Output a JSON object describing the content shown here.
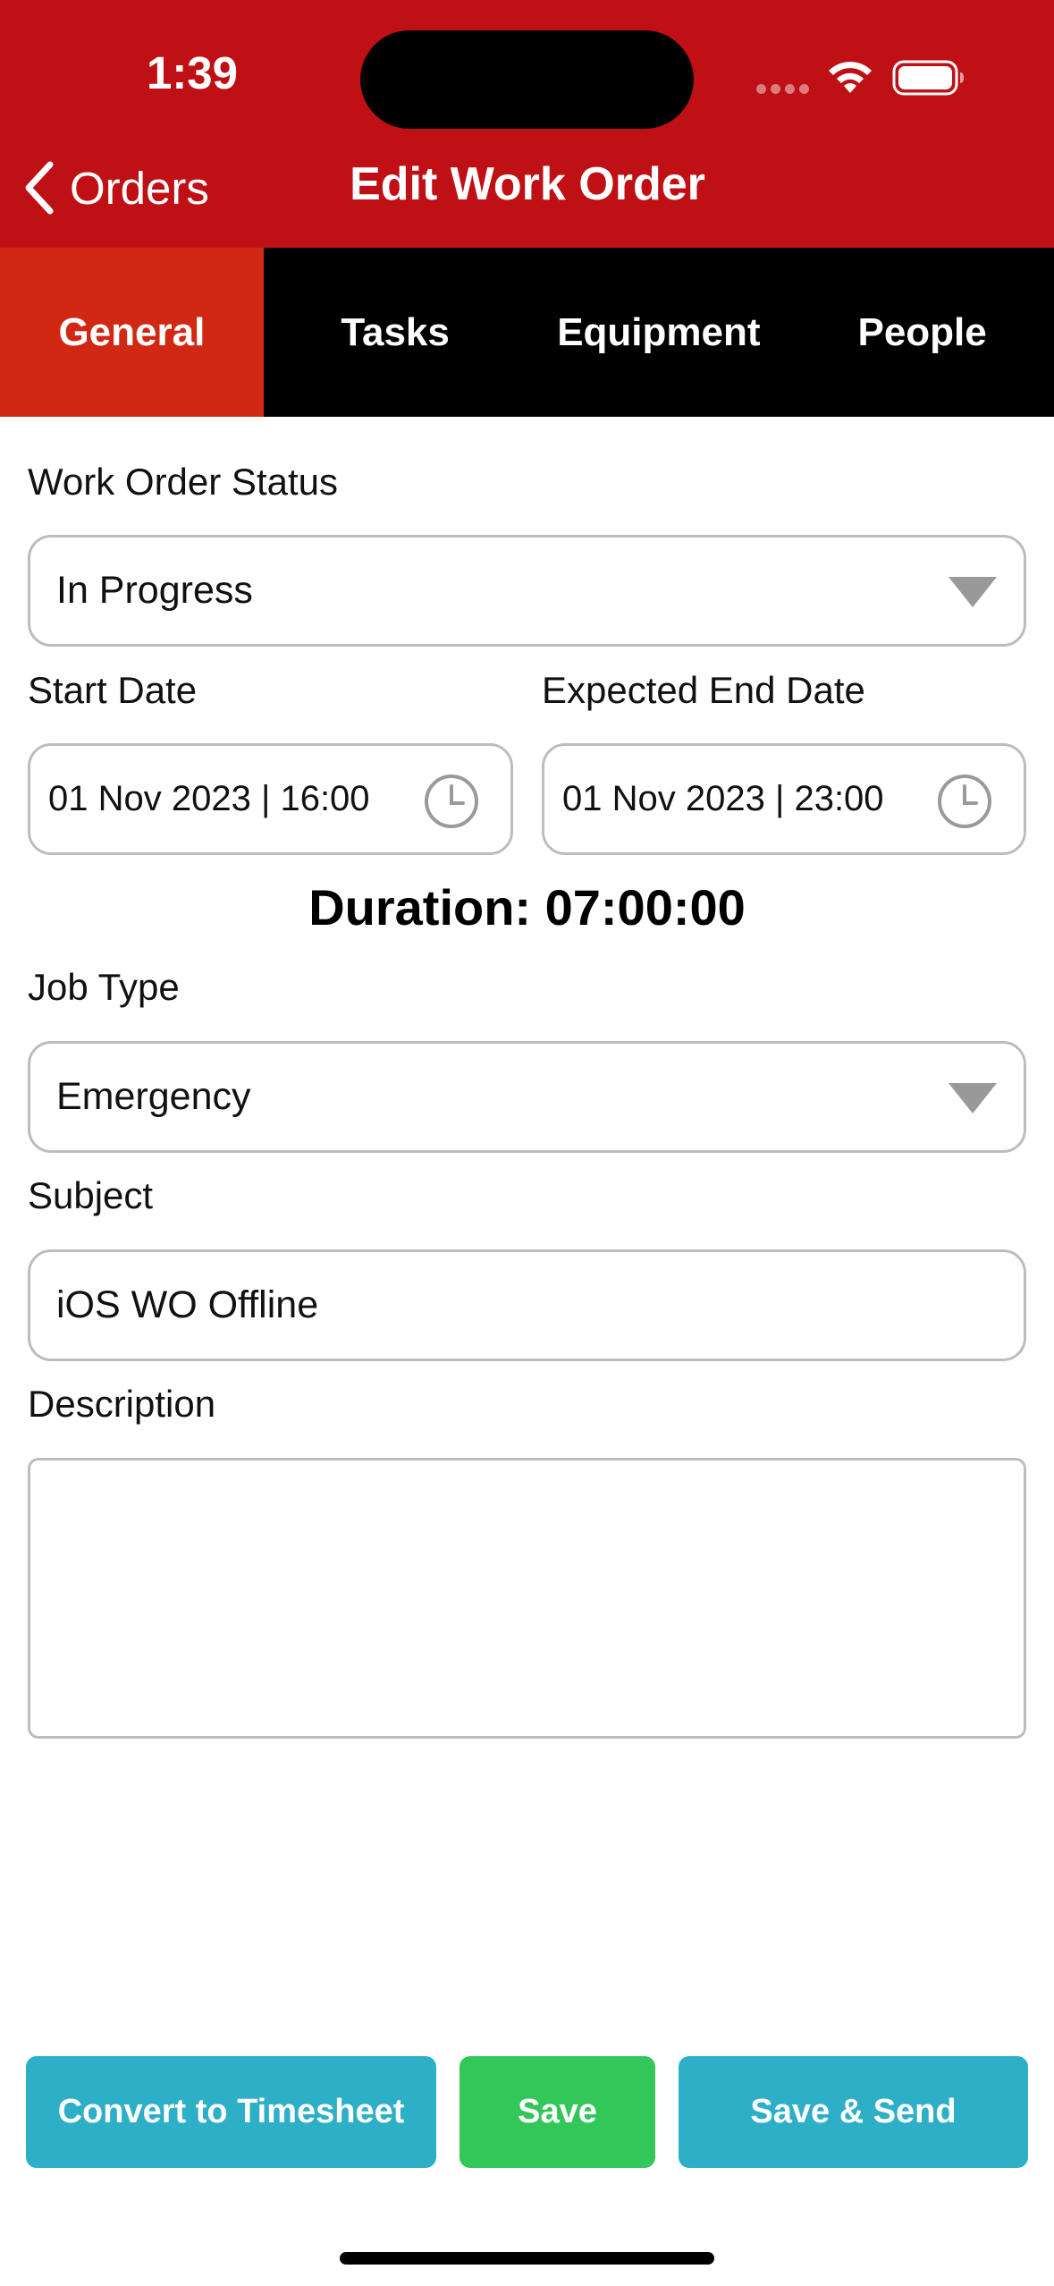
{
  "status_bar": {
    "time": "1:39"
  },
  "nav": {
    "back_label": "Orders",
    "title": "Edit Work Order"
  },
  "tabs": [
    {
      "label": "General",
      "active": true
    },
    {
      "label": "Tasks",
      "active": false
    },
    {
      "label": "Equipment",
      "active": false
    },
    {
      "label": "People",
      "active": false
    }
  ],
  "form": {
    "status_label": "Work Order Status",
    "status_value": "In Progress",
    "start_label": "Start Date",
    "start_value": "01 Nov 2023 | 16:00",
    "end_label": "Expected End Date",
    "end_value": "01 Nov 2023 | 23:00",
    "duration": "Duration: 07:00:00",
    "job_type_label": "Job Type",
    "job_type_value": "Emergency",
    "subject_label": "Subject",
    "subject_value": "iOS WO Offline",
    "description_label": "Description",
    "description_value": ""
  },
  "actions": {
    "convert_label": "Convert to Timesheet",
    "save_label": "Save",
    "save_send_label": "Save & Send"
  },
  "colors": {
    "header": "#bf1015",
    "tab_active": "#d12814",
    "tab_bar": "#000000",
    "button_blue": "#2eafc8",
    "button_green": "#33c659"
  },
  "icons": [
    "chevron-left-icon",
    "wifi-icon",
    "battery-icon",
    "dropdown-caret-icon",
    "clock-icon"
  ]
}
